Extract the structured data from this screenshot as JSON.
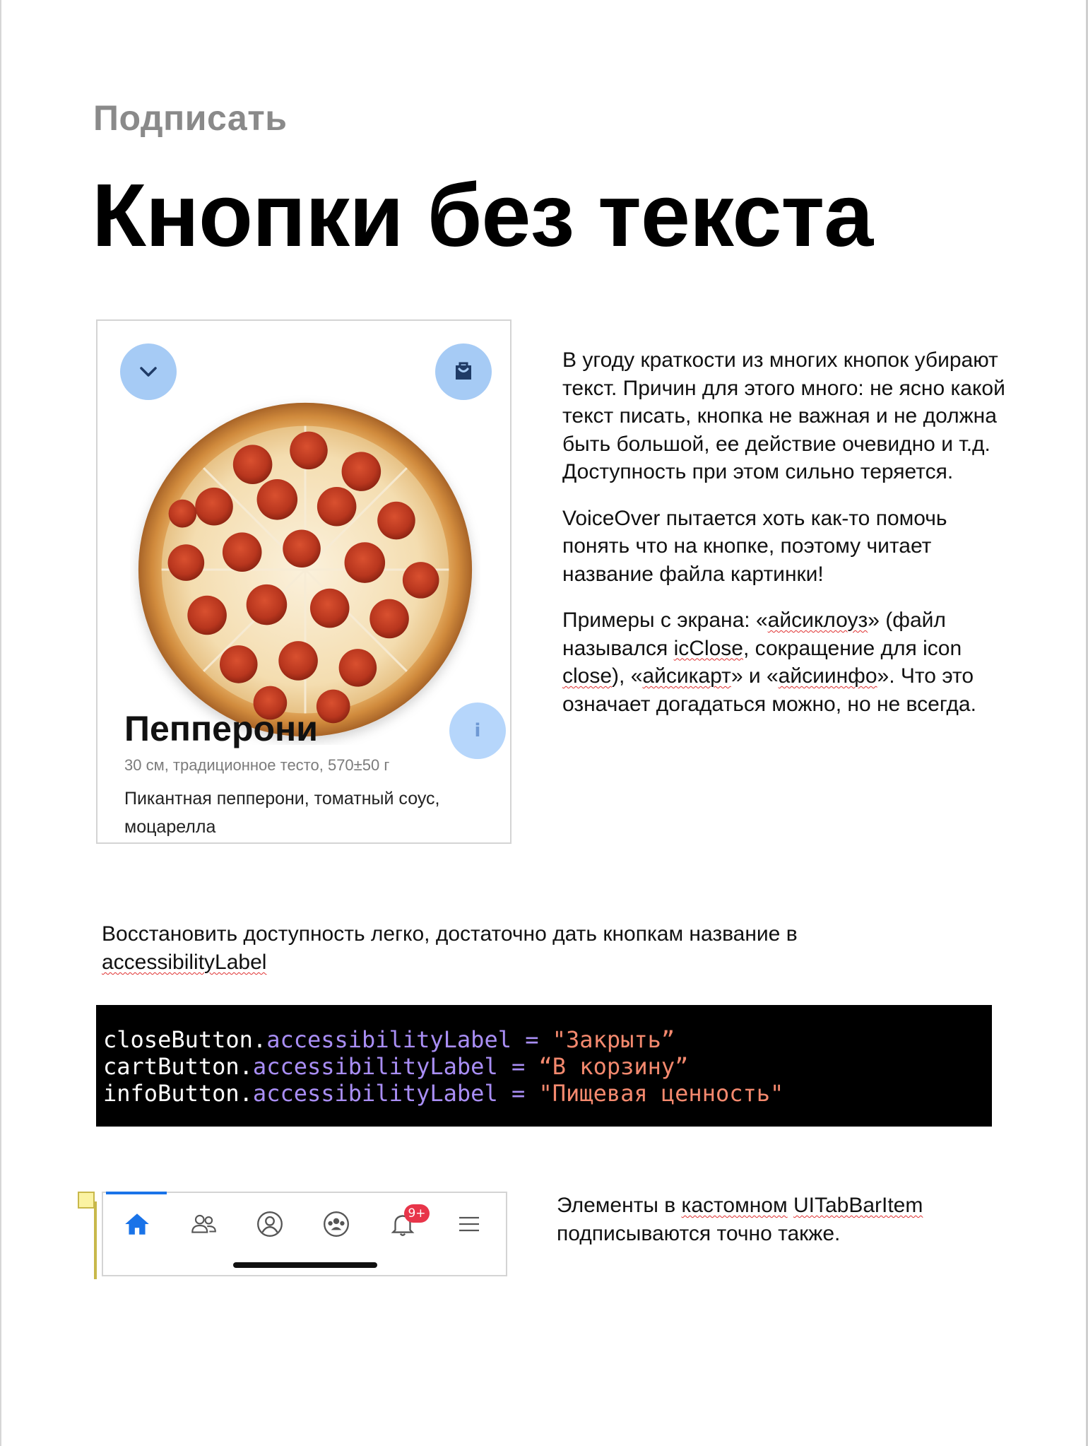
{
  "header": {
    "eyebrow": "Подписать",
    "title": "Кнопки без текста"
  },
  "card": {
    "buttons": {
      "close_icon": "chevron-down-icon",
      "cart_icon": "bag-icon",
      "info_glyph": "i"
    },
    "name": "Пепперони",
    "meta": "30 см, традиционное тесто, 570±50 г",
    "description": "Пикантная пепперони, томатный соус, моцарелла",
    "accent_color": "#a6cbf5"
  },
  "explanation": {
    "p1": "В угоду краткости из многих кнопок убирают текст. Причин для этого много: не ясно какой текст писать, кнопка не важная и не должна быть большой, ее действие очевидно и т.д. Доступность при этом сильно теряется.",
    "p2": "VoiceOver пытается хоть как-то помочь понять что на кнопке, поэтому читает название файла картинки!",
    "p3": {
      "a": "Примеры с экрана: «",
      "w1": "айсиклоуз",
      "b": "» (файл назывался ",
      "w2": "icClose",
      "c": ", сокращение для icon  ",
      "w3": "close",
      "d": "), «",
      "w4": "айсикарт",
      "e": "» и «",
      "w5": "айсиинфо",
      "f": "». Что это означает догадаться можно, но не всегда."
    }
  },
  "restore": {
    "text": "Восстановить доступность легко, достаточно дать кнопкам название в ",
    "term": "accessibilityLabel"
  },
  "code": {
    "lines": [
      {
        "obj": "closeButton",
        "dot": ".",
        "prop": "accessibilityLabel",
        "op": " = ",
        "str": "\"Закрыть”"
      },
      {
        "obj": "cartButton",
        "dot": ".",
        "prop": "accessibilityLabel",
        "op": " = ",
        "str": "“В корзину”"
      },
      {
        "obj": "infoButton",
        "dot": ".",
        "prop": "accessibilityLabel",
        "op": " = ",
        "str": "\"Пищевая ценность\""
      }
    ],
    "colors": {
      "background": "#000000",
      "property": "#a98ef5",
      "string": "#f4896e"
    }
  },
  "tabbar": {
    "items": [
      {
        "icon": "home-icon",
        "active": true
      },
      {
        "icon": "friends-icon"
      },
      {
        "icon": "profile-icon"
      },
      {
        "icon": "groups-icon"
      },
      {
        "icon": "bell-icon",
        "badge": "9+"
      },
      {
        "icon": "menu-icon"
      }
    ],
    "active_color": "#1a73e8",
    "badge_color": "#e8354a"
  },
  "tab_note": {
    "a": "Элементы в ",
    "w1": "кастомном",
    "b": " ",
    "w2": "UITabBarItem",
    "c": " подписываются точно также."
  }
}
